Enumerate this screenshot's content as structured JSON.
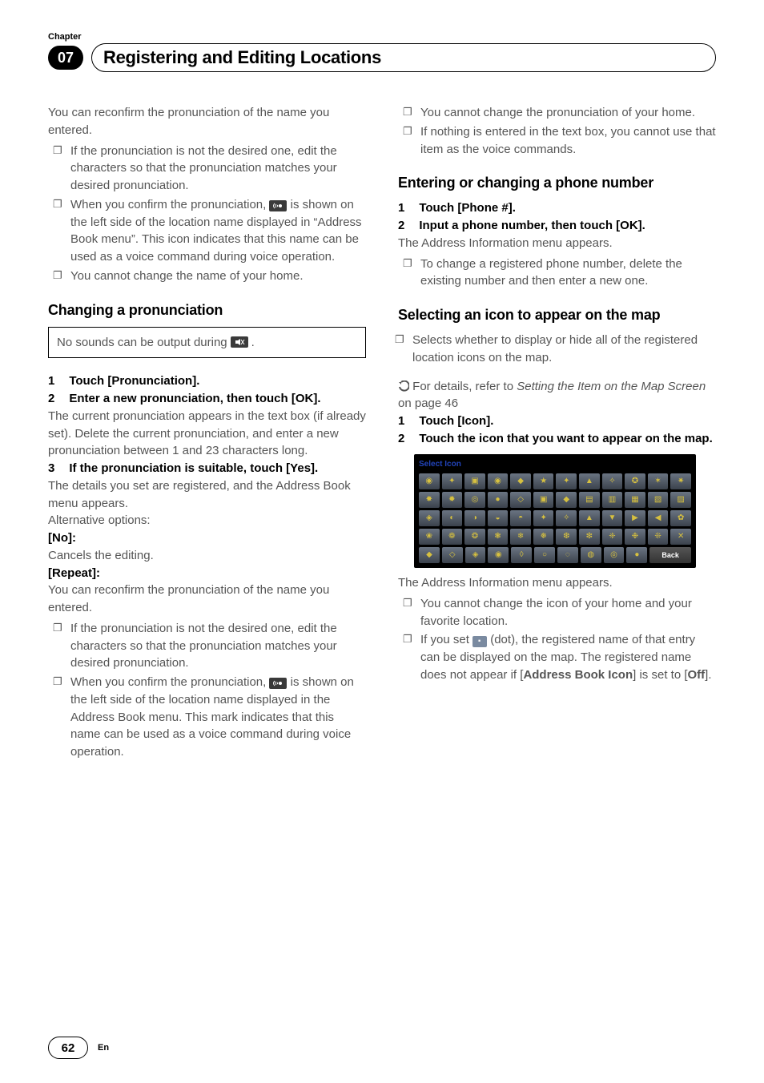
{
  "chapter": {
    "label": "Chapter",
    "number": "07"
  },
  "page_title": "Registering and Editing Locations",
  "left": {
    "intro": "You can reconfirm the pronunciation of the name you entered.",
    "intro_bullets": [
      "If the pronunciation is not the desired one, edit the characters so that the pronunciation matches your desired pronunciation.",
      "When you confirm the pronunciation,   is shown on the left side of the location name displayed in “Address Book menu”. This icon indicates that this name can be used as a voice command during voice operation.",
      "You cannot change the name of your home."
    ],
    "sect_title": "Changing a pronunciation",
    "note_before": "No sounds can be output during",
    "note_after": ".",
    "steps": {
      "1": {
        "head": "Touch [Pronunciation]."
      },
      "2": {
        "head": "Enter a new pronunciation, then touch [OK].",
        "body": "The current pronunciation appears in the text box (if already set). Delete the current pronunciation, and enter a new pronunciation between 1 and 23 characters long."
      },
      "3": {
        "head": "If the pronunciation is suitable, touch [Yes].",
        "body1": "The details you set are registered, and the Address Book menu appears.",
        "alt_label": "Alternative options:",
        "no_label": "[No]:",
        "no_body": "Cancels the editing.",
        "repeat_label": "[Repeat]:",
        "repeat_body": "You can reconfirm the pronunciation of the name you entered.",
        "repeat_bullets": [
          "If the pronunciation is not the desired one, edit the characters so that the pronunciation matches your desired pronunciation.",
          "When you confirm the pronunciation,   is shown on the left side of the location name displayed in the Address Book menu. This mark indicates that this name can be used as a voice command during voice operation."
        ]
      }
    }
  },
  "right": {
    "top_bullets": [
      "You cannot change the pronunciation of your home.",
      "If nothing is entered in the text box, you cannot use that item as the voice commands."
    ],
    "phone": {
      "title": "Entering or changing a phone number",
      "step1": "Touch [Phone #].",
      "step2_head": "Input a phone number, then touch [OK].",
      "step2_body": "The Address Information menu appears.",
      "step2_bullet": "To change a registered phone number, delete the existing number and then enter a new one."
    },
    "icon": {
      "title": "Selecting an icon to appear on the map",
      "lead_bullet": "Selects whether to display or hide all of the registered location icons on the map.",
      "ref_before": "For details, refer to ",
      "ref_italic": "Setting the Item on the Map Screen",
      "ref_after": " on page 46",
      "step1": "Touch [Icon].",
      "step2": "Touch the icon that you want to appear on the map.",
      "grid_title": "Select Icon",
      "grid_back": "Back",
      "after_grid": "The Address Information menu appears.",
      "after_bullets_1": "You cannot change the icon of your home and your favorite location.",
      "after_bullets_2a": "If you set ",
      "after_bullets_2b": " (dot), the registered name of that entry can be displayed on the map. The registered name does not appear if [",
      "after_bullets_2c": "Address Book Icon",
      "after_bullets_2d": "] is set to [",
      "after_bullets_2e": "Off",
      "after_bullets_2f": "]."
    }
  },
  "footer": {
    "page": "62",
    "lang": "En"
  }
}
